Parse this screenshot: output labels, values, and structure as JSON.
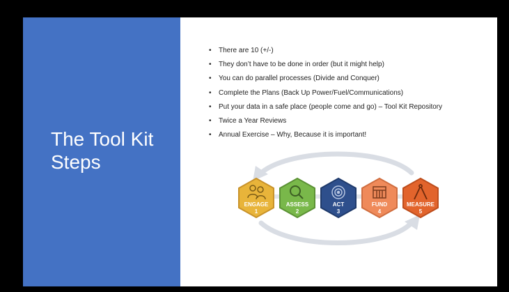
{
  "slide": {
    "title": "The Tool Kit Steps",
    "bullets": [
      "There are 10 (+/-)",
      "They don’t have to be done in order (but it might help)",
      "You can do parallel processes (Divide and Conquer)",
      "Complete the Plans (Back Up Power/Fuel/Communications)",
      "Put your data in a safe place (people come and go) – Tool Kit Repository",
      "Twice a Year Reviews",
      "Annual Exercise – Why, Because it is important!"
    ],
    "steps": [
      {
        "label": "ENGAGE",
        "number": "1",
        "color": "#e8b43a",
        "icon": "people-gears-icon"
      },
      {
        "label": "ASSESS",
        "number": "2",
        "color": "#79b84a",
        "icon": "magnifier-icon"
      },
      {
        "label": "ACT",
        "number": "3",
        "color": "#2e4f8c",
        "icon": "target-icon"
      },
      {
        "label": "FUND",
        "number": "4",
        "color": "#ef8a5a",
        "icon": "building-icon"
      },
      {
        "label": "MEASURE",
        "number": "5",
        "color": "#e2642c",
        "icon": "compass-icon"
      }
    ],
    "colors": {
      "left_panel": "#4472c4",
      "arrow": "#d9dde4"
    }
  }
}
